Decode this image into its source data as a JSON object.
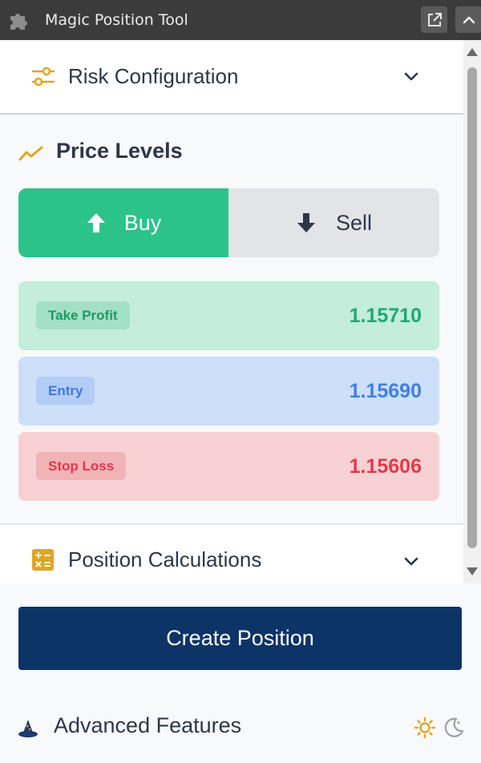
{
  "window": {
    "title": "Magic Position Tool"
  },
  "risk_section": {
    "label": "Risk Configuration"
  },
  "price_levels": {
    "title": "Price Levels",
    "direction": {
      "buy_label": "Buy",
      "sell_label": "Sell",
      "selected": "Buy"
    },
    "levels": [
      {
        "tag": "Take Profit",
        "value": "1.15710",
        "color": "#22a874"
      },
      {
        "tag": "Entry",
        "value": "1.15690",
        "color": "#3f7fe6"
      },
      {
        "tag": "Stop Loss",
        "value": "1.15606",
        "color": "#e23a4a"
      }
    ]
  },
  "calculations_section": {
    "label": "Position Calculations"
  },
  "create_button": {
    "label": "Create Position"
  },
  "advanced": {
    "label": "Advanced Features"
  },
  "colors": {
    "accent_gold": "#e0a526",
    "buy_green": "#2cc38a",
    "primary_navy": "#0d3466"
  },
  "icons": {
    "titlebar": "puzzle-icon",
    "risk": "sliders-icon",
    "price_levels": "trend-line-icon",
    "calculations": "calculator-icon",
    "advanced": "wizard-hat-icon",
    "theme_light": "sun-icon",
    "theme_dark": "moon-icon"
  }
}
